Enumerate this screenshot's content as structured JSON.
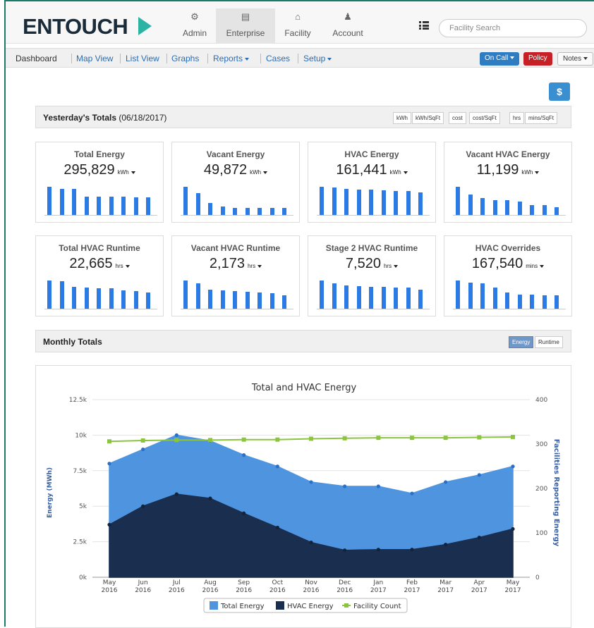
{
  "header": {
    "logo": "ENTOUCH",
    "nav": [
      {
        "label": "Admin",
        "icon": "gear-icon"
      },
      {
        "label": "Enterprise",
        "icon": "briefcase-icon"
      },
      {
        "label": "Facility",
        "icon": "home-icon"
      },
      {
        "label": "Account",
        "icon": "user-icon"
      }
    ],
    "search_placeholder": "Facility Search"
  },
  "subnav": {
    "links": [
      "Dashboard",
      "Map View",
      "List View",
      "Graphs",
      "Reports",
      "Cases",
      "Setup"
    ],
    "oncall_label": "On Call",
    "policy_label": "Policy",
    "notes_label": "Notes"
  },
  "dollar_label": "$",
  "yesterday": {
    "title": "Yesterday's Totals",
    "date": "(06/18/2017)",
    "unit_buttons": [
      "kWh",
      "kWh/SqFt",
      "cost",
      "cost/SqFt",
      "hrs",
      "mins/SqFt"
    ]
  },
  "cards": [
    {
      "title": "Total Energy",
      "value": "295,829",
      "unit": "kWh",
      "bars": [
        0.95,
        0.87,
        0.87,
        0.62,
        0.62,
        0.62,
        0.62,
        0.6,
        0.6
      ]
    },
    {
      "title": "Vacant Energy",
      "value": "49,872",
      "unit": "kWh",
      "bars": [
        0.95,
        0.75,
        0.4,
        0.28,
        0.25,
        0.25,
        0.25,
        0.25,
        0.25
      ]
    },
    {
      "title": "HVAC Energy",
      "value": "161,441",
      "unit": "kWh",
      "bars": [
        0.95,
        0.92,
        0.88,
        0.86,
        0.85,
        0.83,
        0.82,
        0.8,
        0.77
      ]
    },
    {
      "title": "Vacant HVAC Energy",
      "value": "11,199",
      "unit": "kWh",
      "bars": [
        0.95,
        0.7,
        0.57,
        0.5,
        0.5,
        0.45,
        0.33,
        0.33,
        0.26
      ]
    },
    {
      "title": "Total HVAC Runtime",
      "value": "22,665",
      "unit": "hrs",
      "bars": [
        0.95,
        0.92,
        0.75,
        0.72,
        0.7,
        0.68,
        0.62,
        0.6,
        0.55
      ]
    },
    {
      "title": "Vacant HVAC Runtime",
      "value": "2,173",
      "unit": "hrs",
      "bars": [
        0.95,
        0.85,
        0.65,
        0.62,
        0.6,
        0.57,
        0.55,
        0.52,
        0.45
      ]
    },
    {
      "title": "Stage 2 HVAC Runtime",
      "value": "7,520",
      "unit": "hrs",
      "bars": [
        0.95,
        0.85,
        0.78,
        0.76,
        0.75,
        0.73,
        0.72,
        0.72,
        0.65
      ]
    },
    {
      "title": "HVAC Overrides",
      "value": "167,540",
      "unit": "mins",
      "bars": [
        0.95,
        0.88,
        0.85,
        0.72,
        0.55,
        0.48,
        0.48,
        0.45,
        0.45
      ]
    }
  ],
  "monthly": {
    "title": "Monthly Totals",
    "toggle": [
      "Energy",
      "Runtime"
    ],
    "active_toggle": "Energy"
  },
  "chart_data": {
    "type": "area",
    "title": "Total and HVAC Energy",
    "ylabel": "Energy (MWh)",
    "y2label": "Facilities Reporting Energy",
    "ylim": [
      0,
      12500
    ],
    "y2lim": [
      0,
      400
    ],
    "yticks": [
      "0k",
      "2.5k",
      "5k",
      "7.5k",
      "10k",
      "12.5k"
    ],
    "y2ticks": [
      "0",
      "100",
      "200",
      "300",
      "400"
    ],
    "categories": [
      [
        "May",
        "2016"
      ],
      [
        "Jun",
        "2016"
      ],
      [
        "Jul",
        "2016"
      ],
      [
        "Aug",
        "2016"
      ],
      [
        "Sep",
        "2016"
      ],
      [
        "Oct",
        "2016"
      ],
      [
        "Nov",
        "2016"
      ],
      [
        "Dec",
        "2016"
      ],
      [
        "Jan",
        "2017"
      ],
      [
        "Feb",
        "2017"
      ],
      [
        "Mar",
        "2017"
      ],
      [
        "Apr",
        "2017"
      ],
      [
        "May",
        "2017"
      ]
    ],
    "series": [
      {
        "name": "Total Energy",
        "axis": "left",
        "color": "#4e94de",
        "values": [
          8000,
          9000,
          10000,
          9600,
          8600,
          7800,
          6700,
          6400,
          6400,
          5900,
          6700,
          7200,
          7800
        ]
      },
      {
        "name": "HVAC Energy",
        "axis": "left",
        "color": "#1a2e4f",
        "values": [
          3700,
          5000,
          5850,
          5550,
          4500,
          3500,
          2450,
          1900,
          1950,
          1950,
          2300,
          2800,
          3400
        ]
      },
      {
        "name": "Facility Count",
        "axis": "right",
        "color": "#8bc53f",
        "values": [
          306,
          308,
          309,
          309,
          310,
          310,
          312,
          313,
          314,
          314,
          314,
          315,
          316
        ]
      }
    ],
    "legend_position": "bottom"
  }
}
